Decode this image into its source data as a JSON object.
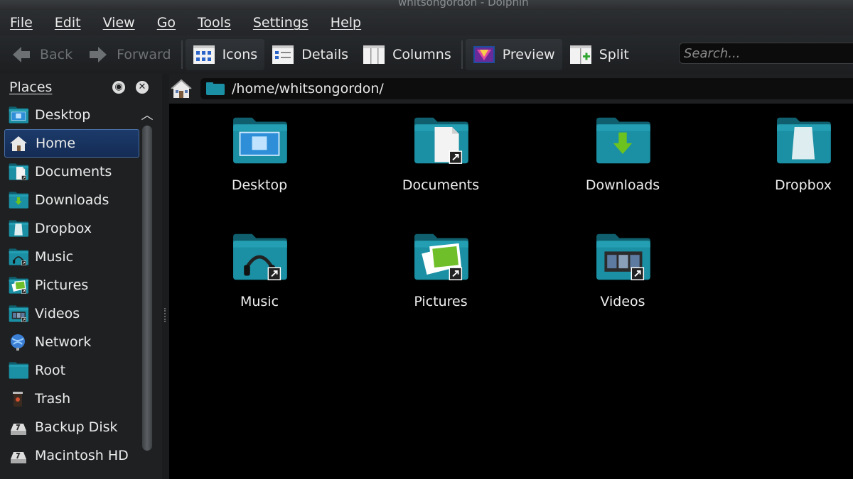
{
  "window": {
    "title": "whitsongordon - Dolphin"
  },
  "menu": [
    "File",
    "Edit",
    "View",
    "Go",
    "Tools",
    "Settings",
    "Help"
  ],
  "toolbar": {
    "back": "Back",
    "forward": "Forward",
    "icons": "Icons",
    "details": "Details",
    "columns": "Columns",
    "preview": "Preview",
    "split": "Split",
    "search_placeholder": "Search..."
  },
  "sidebar": {
    "header": "Places",
    "items": [
      {
        "label": "Desktop",
        "icon": "desktop-folder-icon"
      },
      {
        "label": "Home",
        "icon": "home-icon",
        "selected": true
      },
      {
        "label": "Documents",
        "icon": "documents-folder-icon"
      },
      {
        "label": "Downloads",
        "icon": "downloads-folder-icon"
      },
      {
        "label": "Dropbox",
        "icon": "dropbox-folder-icon"
      },
      {
        "label": "Music",
        "icon": "music-folder-icon"
      },
      {
        "label": "Pictures",
        "icon": "pictures-folder-icon"
      },
      {
        "label": "Videos",
        "icon": "videos-folder-icon"
      },
      {
        "label": "Network",
        "icon": "network-icon"
      },
      {
        "label": "Root",
        "icon": "root-folder-icon"
      },
      {
        "label": "Trash",
        "icon": "trash-icon"
      },
      {
        "label": "Backup Disk",
        "icon": "drive-icon"
      },
      {
        "label": "Macintosh HD",
        "icon": "drive-icon"
      }
    ]
  },
  "location": {
    "path": "/home/whitsongordon/"
  },
  "files": [
    {
      "name": "Desktop",
      "icon": "desktop-folder-icon"
    },
    {
      "name": "Documents",
      "icon": "documents-folder-icon"
    },
    {
      "name": "Downloads",
      "icon": "downloads-folder-icon"
    },
    {
      "name": "Dropbox",
      "icon": "dropbox-folder-icon"
    },
    {
      "name": "Music",
      "icon": "music-folder-icon"
    },
    {
      "name": "Pictures",
      "icon": "pictures-folder-icon"
    },
    {
      "name": "Videos",
      "icon": "videos-folder-icon"
    }
  ],
  "colors": {
    "folder": "#1b8fa3",
    "folder_dark": "#0f5f6e",
    "selection": "#1c3a6a"
  }
}
